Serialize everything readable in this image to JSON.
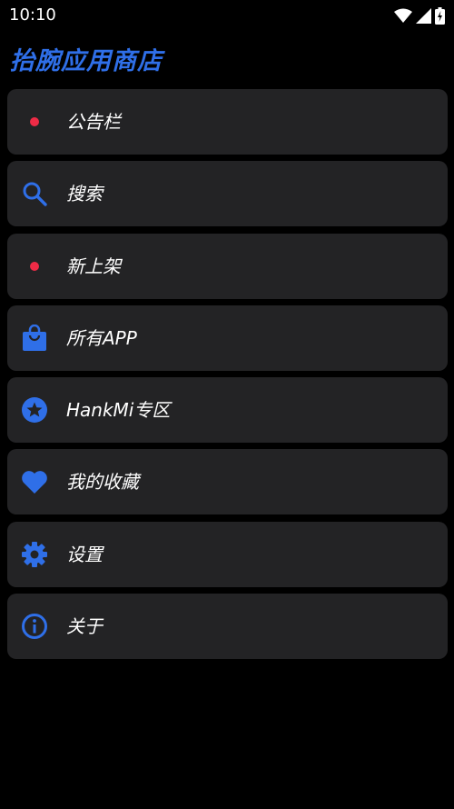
{
  "status_bar": {
    "time": "10:10",
    "icons": [
      "wifi-icon",
      "signal-icon",
      "battery-icon"
    ]
  },
  "app": {
    "title": "抬腕应用商店",
    "accent_color": "#2f6fe8",
    "dot_color": "#ee2b46",
    "card_color": "#232325"
  },
  "menu": {
    "items": [
      {
        "label": "公告栏",
        "icon": "red-dot-indicator"
      },
      {
        "label": "搜索",
        "icon": "search-icon"
      },
      {
        "label": "新上架",
        "icon": "red-dot-indicator"
      },
      {
        "label": "所有APP",
        "icon": "shopping-bag-icon"
      },
      {
        "label": "HankMi专区",
        "icon": "star-badge-icon"
      },
      {
        "label": "我的收藏",
        "icon": "heart-icon"
      },
      {
        "label": "设置",
        "icon": "gear-icon"
      },
      {
        "label": "关于",
        "icon": "info-icon"
      }
    ]
  }
}
